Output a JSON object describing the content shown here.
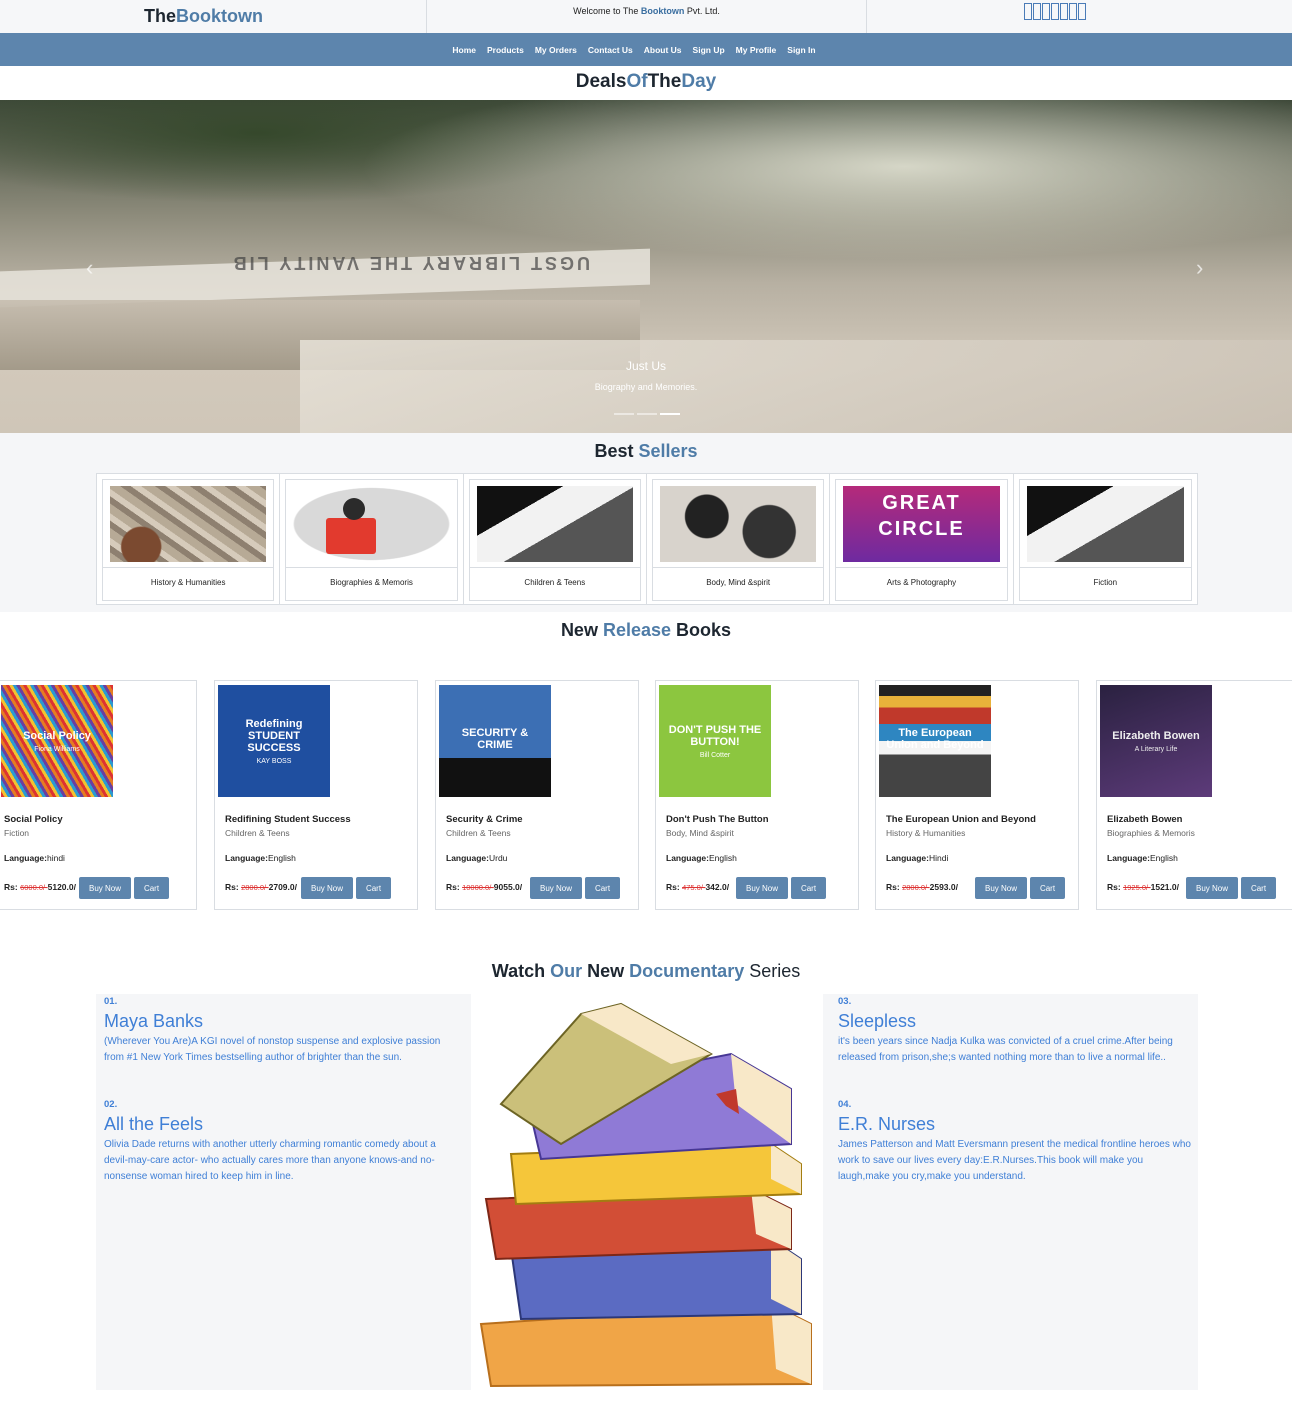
{
  "header": {
    "brand_prefix": "The",
    "brand_accent": "Booktown",
    "welcome_prefix": "Welcome to The ",
    "welcome_accent": "Booktown",
    "welcome_suffix": " Pvt. Ltd."
  },
  "nav": [
    "Home",
    "Products",
    "My Orders",
    "Contact Us",
    "About Us",
    "Sign Up",
    "My Profile",
    "Sign In"
  ],
  "deals": {
    "t1": "Deals",
    "t2": "Of",
    "t3": "The",
    "t4": "Day"
  },
  "hero": {
    "caption_title": "Just Us",
    "caption_subtitle": "Biography and Memories.",
    "spine_text": "UGST LIBRARY          THE VANITY LIB"
  },
  "best_sellers": {
    "title_1": "Best",
    "title_2": "Sellers",
    "items": [
      {
        "label": "History & Humanities"
      },
      {
        "label": "Biographies & Memoris"
      },
      {
        "label": "Children & Teens"
      },
      {
        "label": "Body, Mind &spirit"
      },
      {
        "label": "Arts & Photography"
      },
      {
        "label": "Fiction"
      }
    ]
  },
  "new_release": {
    "title_1": "New",
    "title_2": "Release",
    "title_3": "Books",
    "language_label": "Language:",
    "currency": "Rs:",
    "buy_label": "Buy Now",
    "cart_label": "Cart",
    "books": [
      {
        "title": "Social Policy",
        "category": "Fiction",
        "language": "hindi",
        "old_price": "6000.0/-",
        "price": "5120.0/"
      },
      {
        "title": "Redifining Student Success",
        "category": "Children & Teens",
        "language": "English",
        "old_price": "2800.0/-",
        "price": "2709.0/"
      },
      {
        "title": "Security & Crime",
        "category": "Children & Teens",
        "language": "Urdu",
        "old_price": "10000.0/-",
        "price": "9055.0/"
      },
      {
        "title": "Don't Push The Button",
        "category": "Body, Mind &spirit",
        "language": "English",
        "old_price": "475.0/-",
        "price": "342.0/"
      },
      {
        "title": "The European Union and Beyond",
        "category": "History & Humanities",
        "language": "Hindi",
        "old_price": "2800.0/-",
        "price": "2593.0/"
      },
      {
        "title": "Elizabeth Bowen",
        "category": "Biographies & Memoris",
        "language": "English",
        "old_price": "1925.0/-",
        "price": "1521.0/"
      }
    ],
    "covers": [
      {
        "text": "Social Policy",
        "sub": "Fiona Williams"
      },
      {
        "text": "Redefining STUDENT SUCCESS",
        "sub": "KAY BOSS"
      },
      {
        "text": "SECURITY & CRIME",
        "sub": ""
      },
      {
        "text": "DON'T PUSH THE BUTTON!",
        "sub": "Bill Cotter"
      },
      {
        "text": "The European Union and Beyond",
        "sub": ""
      },
      {
        "text": "Elizabeth Bowen",
        "sub": "A Literary Life"
      }
    ]
  },
  "documentary": {
    "t1": "Watch",
    "t2": "Our",
    "t3": "New",
    "t4": "Documentary",
    "t5": "Series",
    "items": [
      {
        "num": "01.",
        "title": "Maya Banks",
        "text": "(Wherever You Are)A KGI novel of nonstop suspense and explosive passion from #1 New York Times bestselling author of brighter than the sun."
      },
      {
        "num": "02.",
        "title": "All the Feels",
        "text": "Olivia Dade returns with another utterly charming romantic comedy about a devil-may-care actor- who actually cares more than anyone knows-and no-nonsense woman hired to keep him in line."
      },
      {
        "num": "03.",
        "title": "Sleepless",
        "text": "it's been years since Nadja Kulka was convicted of a cruel crime.After being released from prison,she;s wanted nothing more than to live a normal life.."
      },
      {
        "num": "04.",
        "title": "E.R. Nurses",
        "text": "James Patterson and Matt Eversmann present the medical frontline heroes who work to save our lives every day:E.R.Nurses.This book will make you laugh,make you cry,make you understand."
      }
    ]
  },
  "colors": {
    "accent": "#4f7ca7",
    "nav_bg": "#5d85ad",
    "link_blue": "#3f7fd6",
    "strike_red": "#d33"
  }
}
